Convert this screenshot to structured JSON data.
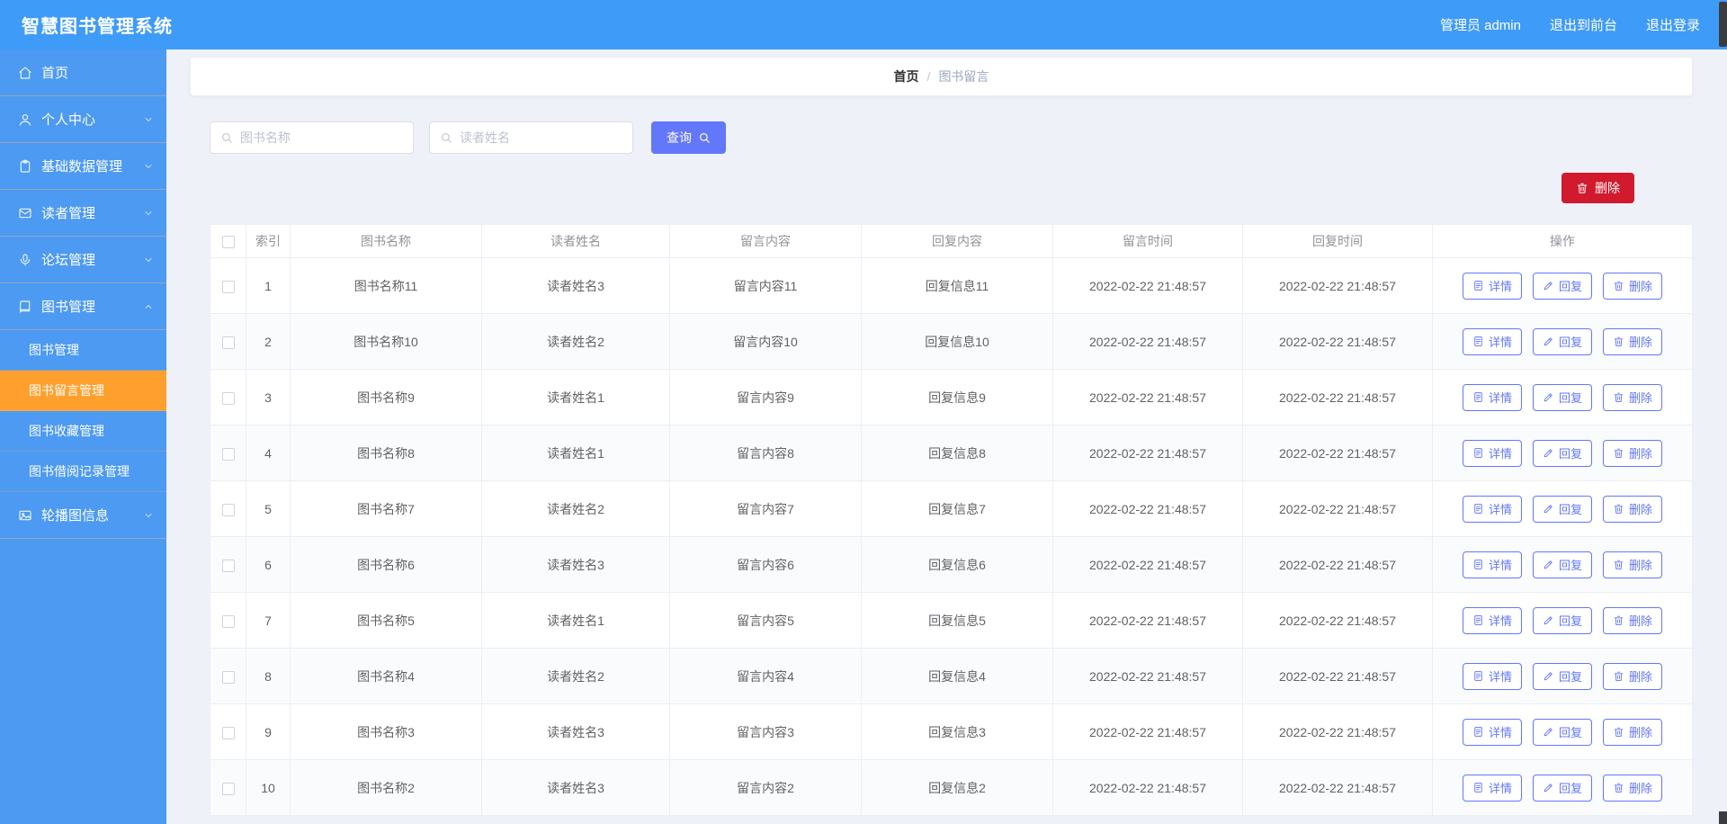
{
  "app": {
    "title": "智慧图书管理系统"
  },
  "header": {
    "user": "管理员 admin",
    "links": [
      "退出到前台",
      "退出登录"
    ]
  },
  "sidebar": {
    "items": [
      {
        "label": "首页",
        "icon": "home-icon"
      },
      {
        "label": "个人中心",
        "icon": "user-icon"
      },
      {
        "label": "基础数据管理",
        "icon": "clipboard-icon"
      },
      {
        "label": "读者管理",
        "icon": "mail-icon"
      },
      {
        "label": "论坛管理",
        "icon": "mic-icon"
      },
      {
        "label": "图书管理",
        "icon": "book-icon",
        "expanded": true,
        "children": [
          {
            "label": "图书管理",
            "active": false
          },
          {
            "label": "图书留言管理",
            "active": true
          },
          {
            "label": "图书收藏管理",
            "active": false
          },
          {
            "label": "图书借阅记录管理",
            "active": false
          }
        ]
      },
      {
        "label": "轮播图信息",
        "icon": "image-icon"
      }
    ]
  },
  "breadcrumb": {
    "home": "首页",
    "separator": "/",
    "current": "图书留言"
  },
  "search": {
    "book_placeholder": "图书名称",
    "reader_placeholder": "读者姓名",
    "query_label": "查询"
  },
  "toolbar": {
    "delete_label": "删除"
  },
  "table": {
    "headers": [
      "索引",
      "图书名称",
      "读者姓名",
      "留言内容",
      "回复内容",
      "留言时间",
      "回复时间",
      "操作"
    ],
    "actions": {
      "detail": "详情",
      "reply": "回复",
      "delete": "删除"
    },
    "rows": [
      {
        "index": 1,
        "book": "图书名称11",
        "reader": "读者姓名3",
        "message": "留言内容11",
        "reply": "回复信息11",
        "message_time": "2022-02-22 21:48:57",
        "reply_time": "2022-02-22 21:48:57"
      },
      {
        "index": 2,
        "book": "图书名称10",
        "reader": "读者姓名2",
        "message": "留言内容10",
        "reply": "回复信息10",
        "message_time": "2022-02-22 21:48:57",
        "reply_time": "2022-02-22 21:48:57"
      },
      {
        "index": 3,
        "book": "图书名称9",
        "reader": "读者姓名1",
        "message": "留言内容9",
        "reply": "回复信息9",
        "message_time": "2022-02-22 21:48:57",
        "reply_time": "2022-02-22 21:48:57"
      },
      {
        "index": 4,
        "book": "图书名称8",
        "reader": "读者姓名1",
        "message": "留言内容8",
        "reply": "回复信息8",
        "message_time": "2022-02-22 21:48:57",
        "reply_time": "2022-02-22 21:48:57"
      },
      {
        "index": 5,
        "book": "图书名称7",
        "reader": "读者姓名2",
        "message": "留言内容7",
        "reply": "回复信息7",
        "message_time": "2022-02-22 21:48:57",
        "reply_time": "2022-02-22 21:48:57"
      },
      {
        "index": 6,
        "book": "图书名称6",
        "reader": "读者姓名3",
        "message": "留言内容6",
        "reply": "回复信息6",
        "message_time": "2022-02-22 21:48:57",
        "reply_time": "2022-02-22 21:48:57"
      },
      {
        "index": 7,
        "book": "图书名称5",
        "reader": "读者姓名1",
        "message": "留言内容5",
        "reply": "回复信息5",
        "message_time": "2022-02-22 21:48:57",
        "reply_time": "2022-02-22 21:48:57"
      },
      {
        "index": 8,
        "book": "图书名称4",
        "reader": "读者姓名2",
        "message": "留言内容4",
        "reply": "回复信息4",
        "message_time": "2022-02-22 21:48:57",
        "reply_time": "2022-02-22 21:48:57"
      },
      {
        "index": 9,
        "book": "图书名称3",
        "reader": "读者姓名3",
        "message": "留言内容3",
        "reply": "回复信息3",
        "message_time": "2022-02-22 21:48:57",
        "reply_time": "2022-02-22 21:48:57"
      },
      {
        "index": 10,
        "book": "图书名称2",
        "reader": "读者姓名3",
        "message": "留言内容2",
        "reply": "回复信息2",
        "message_time": "2022-02-22 21:48:57",
        "reply_time": "2022-02-22 21:48:57"
      }
    ]
  },
  "colors": {
    "brand": "#3f9bf8",
    "sidebar": "#4d9af2",
    "active": "#ffa02e",
    "accent": "#6377fa",
    "danger": "#d11a2d"
  }
}
